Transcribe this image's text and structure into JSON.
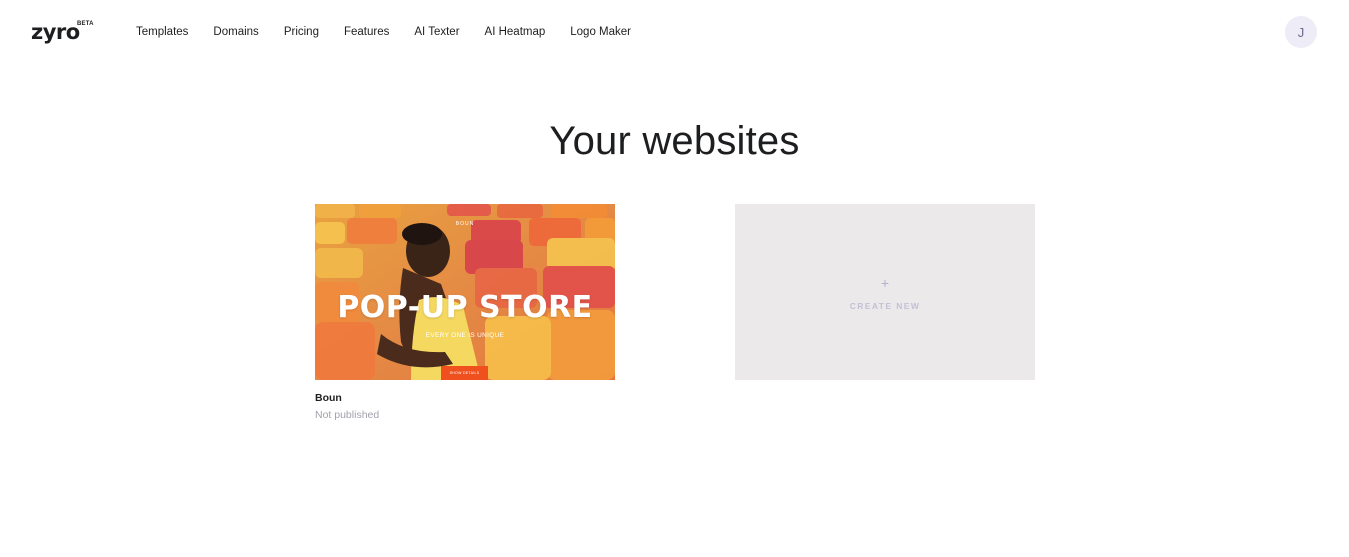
{
  "header": {
    "logo": "zyro",
    "logo_badge": "BETA",
    "nav": [
      {
        "label": "Templates"
      },
      {
        "label": "Domains"
      },
      {
        "label": "Pricing"
      },
      {
        "label": "Features"
      },
      {
        "label": "AI Texter"
      },
      {
        "label": "AI Heatmap"
      },
      {
        "label": "Logo Maker"
      }
    ],
    "avatar_initial": "J"
  },
  "main": {
    "title": "Your websites",
    "sites": [
      {
        "name": "Boun",
        "status": "Not published",
        "thumbnail": {
          "brand": "BOUN",
          "headline": "POP-UP STORE",
          "subheadline": "EVERY ONE IS UNIQUE",
          "button": "SHOW DETAILS"
        }
      }
    ],
    "create_new": {
      "icon": "plus-icon",
      "label": "CREATE NEW"
    }
  },
  "colors": {
    "text": "#1d1e20",
    "muted": "#a3a1ab",
    "avatar_bg": "#eeecf6",
    "create_card_bg": "#ebe9ea",
    "create_label": "#c4c1d6",
    "thumb_button": "#f0501e"
  }
}
